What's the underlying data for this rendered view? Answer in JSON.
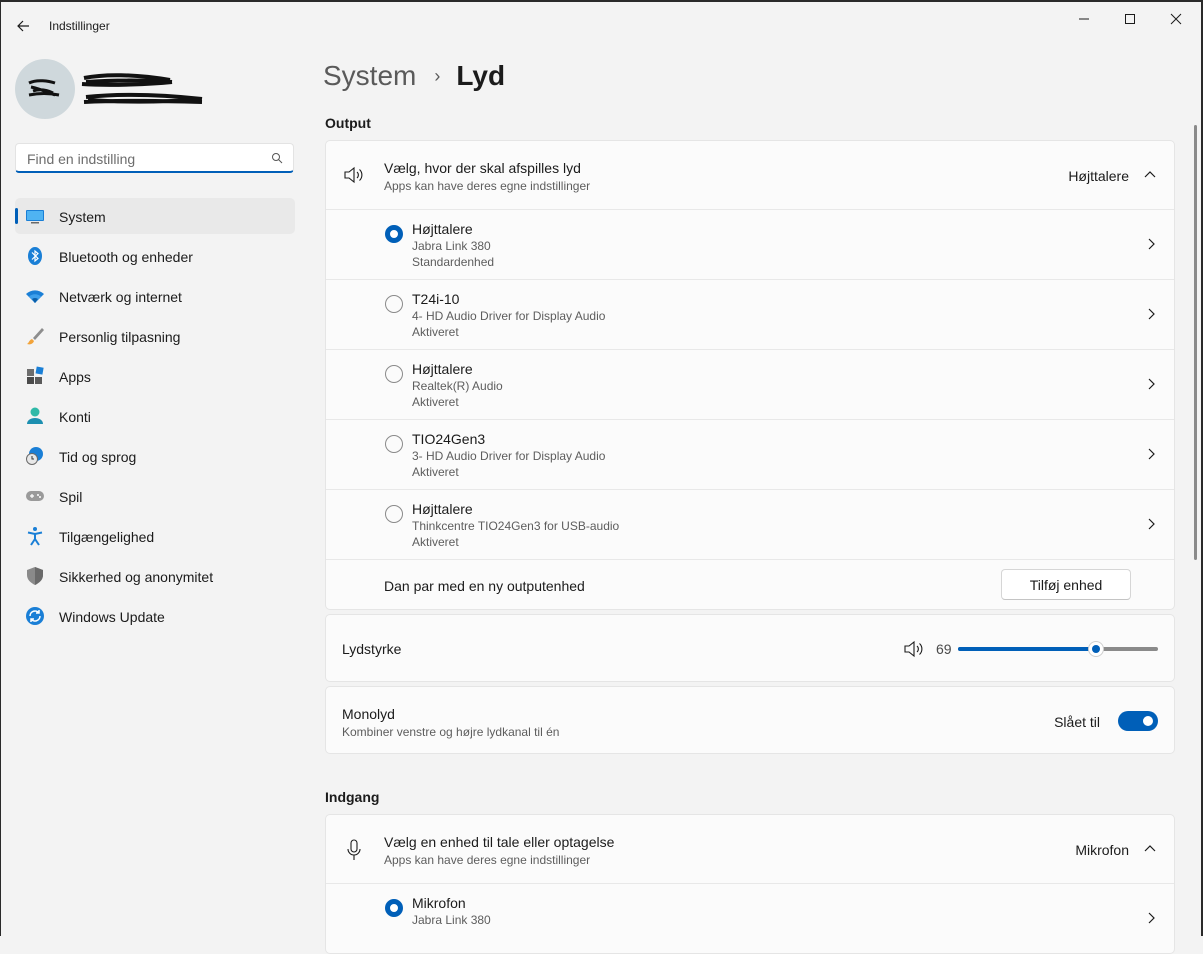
{
  "window": {
    "title": "Indstillinger"
  },
  "search": {
    "placeholder": "Find en indstilling"
  },
  "sidebar": {
    "items": [
      {
        "label": "System",
        "icon": "monitor-icon"
      },
      {
        "label": "Bluetooth og enheder",
        "icon": "bluetooth-icon"
      },
      {
        "label": "Netværk og internet",
        "icon": "wifi-icon"
      },
      {
        "label": "Personlig tilpasning",
        "icon": "brush-icon"
      },
      {
        "label": "Apps",
        "icon": "apps-icon"
      },
      {
        "label": "Konti",
        "icon": "person-icon"
      },
      {
        "label": "Tid og sprog",
        "icon": "clock-globe-icon"
      },
      {
        "label": "Spil",
        "icon": "gamepad-icon"
      },
      {
        "label": "Tilgængelighed",
        "icon": "accessibility-icon"
      },
      {
        "label": "Sikkerhed og anonymitet",
        "icon": "shield-icon"
      },
      {
        "label": "Windows Update",
        "icon": "update-icon"
      }
    ],
    "active_index": 0
  },
  "breadcrumb": {
    "parent": "System",
    "separator": "›",
    "current": "Lyd"
  },
  "output": {
    "heading": "Output",
    "selector": {
      "title": "Vælg, hvor der skal afspilles lyd",
      "subtitle": "Apps kan have deres egne indstillinger",
      "value": "Højttalere"
    },
    "devices": [
      {
        "name": "Højttalere",
        "driver": "Jabra Link 380",
        "status": "Standardenhed",
        "selected": true
      },
      {
        "name": "T24i-10",
        "driver": "4- HD Audio Driver for Display Audio",
        "status": "Aktiveret",
        "selected": false
      },
      {
        "name": "Højttalere",
        "driver": "Realtek(R) Audio",
        "status": "Aktiveret",
        "selected": false
      },
      {
        "name": "TIO24Gen3",
        "driver": "3- HD Audio Driver for Display Audio",
        "status": "Aktiveret",
        "selected": false
      },
      {
        "name": "Højttalere",
        "driver": "Thinkcentre TIO24Gen3 for USB-audio",
        "status": "Aktiveret",
        "selected": false
      }
    ],
    "pair": {
      "label": "Dan par med en ny outputenhed",
      "button": "Tilføj enhed"
    },
    "volume": {
      "label": "Lydstyrke",
      "value": "69",
      "level": 0.69
    },
    "mono": {
      "title": "Monolyd",
      "subtitle": "Kombiner venstre og højre lydkanal til én",
      "state": "Slået til",
      "on": true
    }
  },
  "input": {
    "heading": "Indgang",
    "selector": {
      "title": "Vælg en enhed til tale eller optagelse",
      "subtitle": "Apps kan have deres egne indstillinger",
      "value": "Mikrofon"
    },
    "devices": [
      {
        "name": "Mikrofon",
        "driver": "Jabra Link 380",
        "selected": true
      }
    ]
  },
  "colors": {
    "accent": "#005fb8",
    "background": "#f3f3f3",
    "card": "#fbfbfb"
  }
}
